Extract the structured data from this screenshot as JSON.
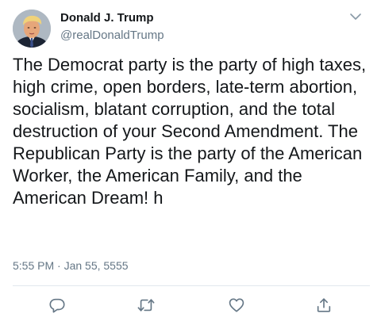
{
  "author": {
    "display_name": "Donald J. Trump",
    "handle": "@realDonaldTrump",
    "avatar_icon": "profile-photo"
  },
  "tweet": {
    "text": "The Democrat party is the party of high taxes, high crime, open borders, late-term abortion, socialism, blatant corruption, and the total destruction of your Second Amendment. The Republican Party is the party of the American Worker, the American Family, and the American Dream! h",
    "timestamp": "5:55 PM · Jan 55, 5555"
  },
  "actions": [
    {
      "name": "reply",
      "icon": "comment-bubble-icon"
    },
    {
      "name": "retweet",
      "icon": "retweet-arrows-icon"
    },
    {
      "name": "like",
      "icon": "heart-icon"
    },
    {
      "name": "share",
      "icon": "share-upload-icon"
    }
  ],
  "colors": {
    "text_primary": "#14171a",
    "text_secondary": "#657786",
    "icon": "#657786",
    "divider": "#e1e8ed"
  }
}
